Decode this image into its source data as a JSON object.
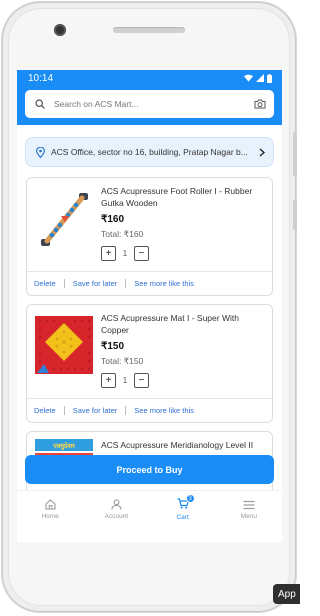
{
  "status": {
    "time": "10:14"
  },
  "search": {
    "placeholder": "Search on ACS Mart..."
  },
  "address": {
    "text": "ACS Office, sector no 16, building, Pratap Nagar b..."
  },
  "cart_items": [
    {
      "title": "ACS Acupressure Foot Roller I - Rubber Gutka Wooden",
      "price": "₹160",
      "total": "Total: ₹160",
      "quantity": "1"
    },
    {
      "title": "ACS Acupressure Mat I - Super With Copper",
      "price": "₹150",
      "total": "Total: ₹150",
      "quantity": "1"
    },
    {
      "title": "ACS Acupressure Meridianology Level II"
    }
  ],
  "item_actions": {
    "delete": "Delete",
    "save": "Save for later",
    "more": "See more like this"
  },
  "qty_controls": {
    "plus": "+",
    "minus": "−"
  },
  "proceed_label": "Proceed to Buy",
  "nav": {
    "home": "Home",
    "account": "Account",
    "cart": "Cart",
    "cart_badge": "3",
    "menu": "Menu"
  },
  "thumb3_banner": "एक्युप्रेशर",
  "overlay": {
    "app_chip": "App"
  },
  "colors": {
    "primary": "#1a8cf5",
    "link": "#2f6fd1"
  }
}
